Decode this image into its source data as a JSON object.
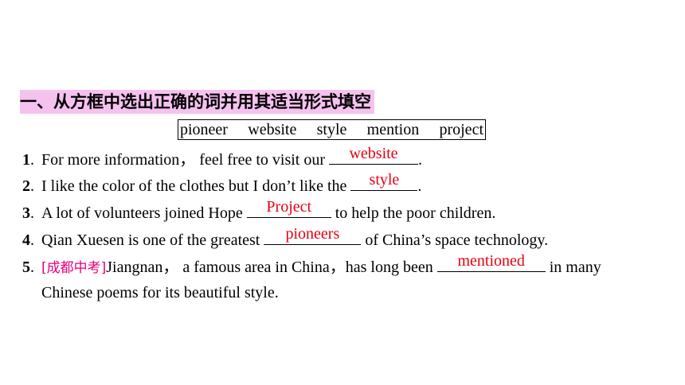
{
  "heading": "一、从方框中选出正确的词并用其适当形式填空",
  "word_box": [
    "pioneer",
    "website",
    "style",
    "mention",
    "project"
  ],
  "questions": [
    {
      "num": "1",
      "before": "For more information，  feel free to visit our ",
      "answer": "website",
      "after": "."
    },
    {
      "num": "2",
      "before": "I like the color of the clothes but I don’t like the ",
      "answer": "style",
      "after": "."
    },
    {
      "num": "3",
      "before": "A lot of volunteers joined Hope ",
      "answer": "Project",
      "after": " to help the poor children."
    },
    {
      "num": "4",
      "before": "Qian Xuesen is one of the greatest ",
      "answer": "pioneers",
      "after": " of China’s space technology."
    },
    {
      "num": "5",
      "tag": "[成都中考]",
      "before": "Jiangnan，  a famous area in China，has long been ",
      "answer": "mentioned",
      "after": " in many",
      "continuation": "Chinese poems for its beautiful style."
    }
  ],
  "colors": {
    "answer": "#e60012",
    "tag": "#e4007f",
    "heading_bg": "#f5c2f0"
  }
}
